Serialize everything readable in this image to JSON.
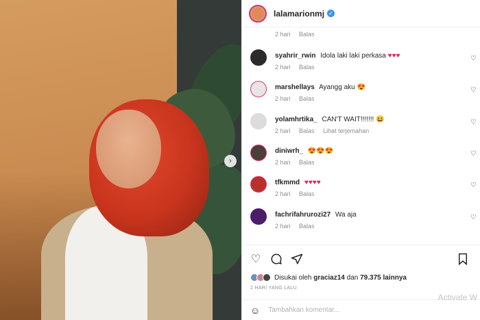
{
  "post": {
    "username": "lalamarionmj",
    "verified": true
  },
  "top_meta": {
    "time": "2 hari",
    "reply": "Balas"
  },
  "comments": [
    {
      "user": "syahrir_rwin",
      "text": "Idola laki laki perkasa",
      "emoji": "♥♥♥",
      "time": "2 hari",
      "reply": "Balas",
      "extra": ""
    },
    {
      "user": "marshellays",
      "text": "Ayangg aku",
      "emoji": "😍",
      "time": "2 hari",
      "reply": "Balas",
      "extra": ""
    },
    {
      "user": "yolamhrtika_",
      "text": "CAN'T WAIT!!!!!!!",
      "emoji": "😆",
      "time": "2 hari",
      "reply": "Balas",
      "extra": "Lihat terjemahan"
    },
    {
      "user": "diniwrh_",
      "text": "",
      "emoji": "😍😍😍",
      "time": "2 hari",
      "reply": "Balas",
      "extra": ""
    },
    {
      "user": "tfkmmd",
      "text": "",
      "emoji": "♥♥♥♥",
      "time": "2 hari",
      "reply": "Balas",
      "extra": ""
    },
    {
      "user": "fachrifahrurozi27",
      "text": "Wa aja",
      "emoji": "",
      "time": "2 hari",
      "reply": "Balas",
      "extra": ""
    }
  ],
  "likes": {
    "prefix": "Disukai oleh",
    "user": "graciaz14",
    "middle": "dan",
    "count": "79.375",
    "suffix": "lainnya"
  },
  "timestamp": "2 HARI YANG LALU",
  "add_comment_placeholder": "Tambahkan komentar...",
  "watermark": "Activate W",
  "icons": {
    "like": "heart-icon",
    "comment": "comment-icon",
    "share": "share-icon",
    "save": "bookmark-icon",
    "emoji": "smile-icon",
    "next": "chevron-right-icon"
  },
  "colors": {
    "verified": "#3897f0",
    "story_ring": "#e1306c"
  }
}
